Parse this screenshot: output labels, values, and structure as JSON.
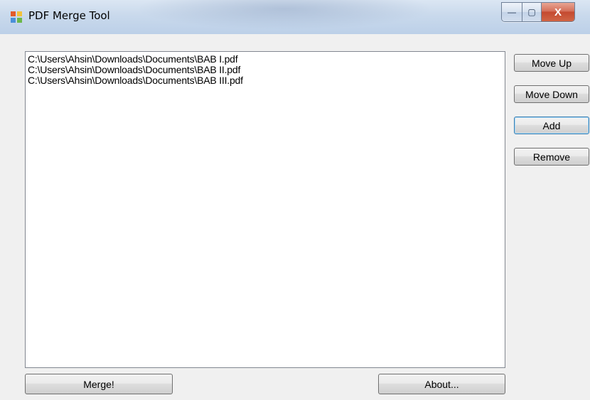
{
  "window": {
    "title": "PDF Merge Tool",
    "controls": {
      "minimize": "—",
      "maximize": "▢",
      "close": "X"
    }
  },
  "file_list": {
    "items": [
      "C:\\Users\\Ahsin\\Downloads\\Documents\\BAB I.pdf",
      "C:\\Users\\Ahsin\\Downloads\\Documents\\BAB II.pdf",
      "C:\\Users\\Ahsin\\Downloads\\Documents\\BAB III.pdf"
    ]
  },
  "side_buttons": {
    "move_up": "Move Up",
    "move_down": "Move Down",
    "add": "Add",
    "remove": "Remove"
  },
  "bottom_buttons": {
    "merge": "Merge!",
    "about": "About..."
  }
}
